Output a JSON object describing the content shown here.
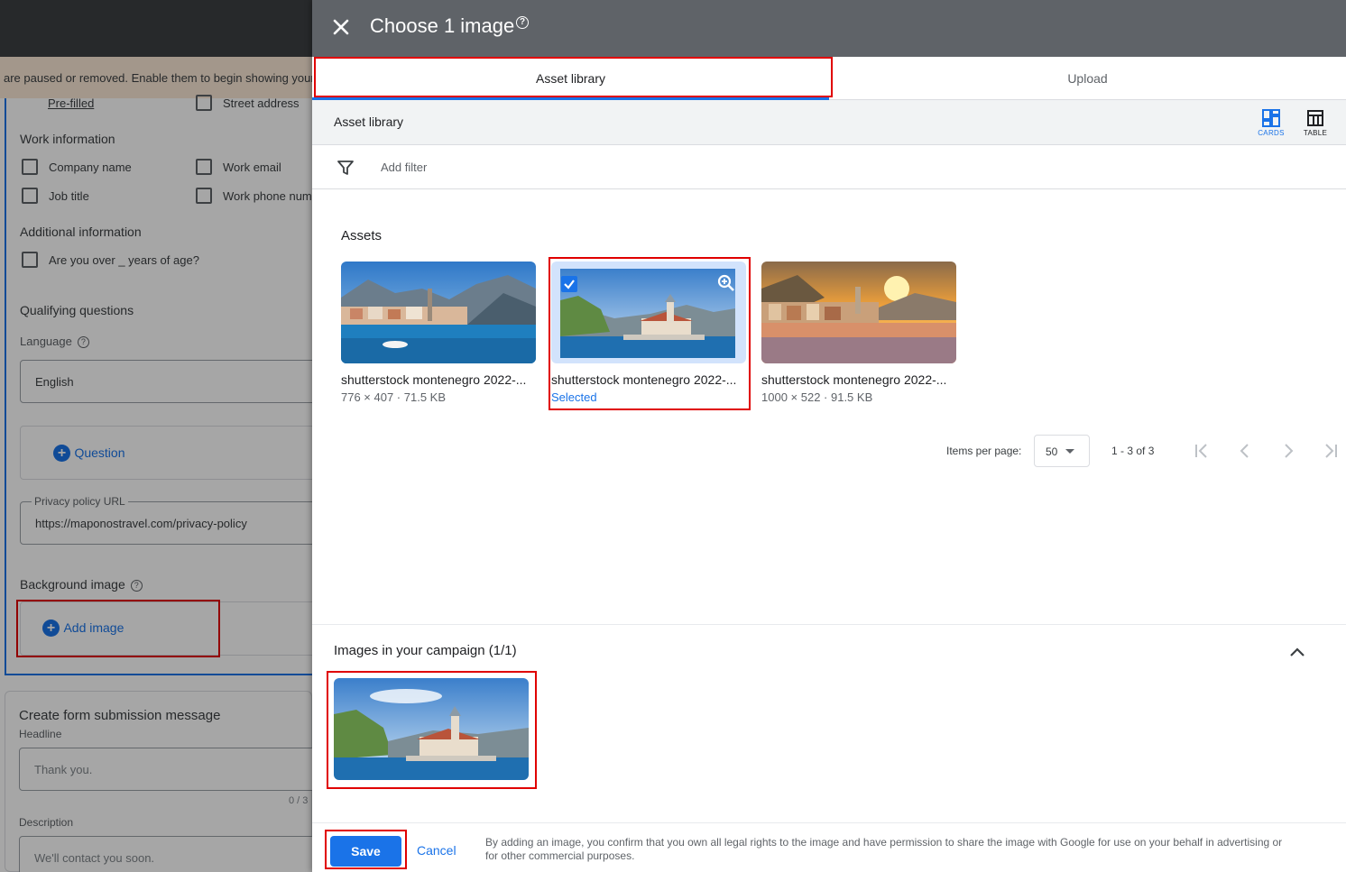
{
  "background_page": {
    "notice": "are paused or removed. Enable them to begin showing your",
    "prefilled_label": "Pre-filled",
    "street_address": "Street address",
    "work_info_title": "Work information",
    "company_name": "Company name",
    "work_email": "Work email",
    "job_title": "Job title",
    "work_phone": "Work phone numb",
    "additional_info_title": "Additional information",
    "age_question": "Are you over _ years of age?",
    "qualifying_title": "Qualifying questions",
    "language_label": "Language",
    "language_value": "English",
    "question_link": "Question",
    "privacy_label": "Privacy policy URL",
    "privacy_value": "https://maponostravel.com/privacy-policy",
    "bg_image_title": "Background image",
    "add_image": "Add image",
    "submission_title": "Create form submission message",
    "headline_label": "Headline",
    "headline_placeholder": "Thank you.",
    "headline_count": "0 / 3",
    "description_label": "Description",
    "description_placeholder": "We'll contact you soon."
  },
  "dialog": {
    "title": "Choose 1 image",
    "close_icon": "close-icon",
    "tabs": [
      {
        "label": "Asset library",
        "active": true
      },
      {
        "label": "Upload",
        "active": false
      }
    ],
    "library_title": "Asset library",
    "views": [
      {
        "label": "CARDS",
        "icon": "cards-icon",
        "active": true
      },
      {
        "label": "TABLE",
        "icon": "table-icon",
        "active": false
      }
    ],
    "filter_placeholder": "Add filter",
    "assets_heading": "Assets",
    "assets": [
      {
        "name": "shutterstock montenegro 2022-...",
        "meta": "776 × 407 · 71.5 KB",
        "selected": false
      },
      {
        "name": "shutterstock montenegro 2022-...",
        "meta": "Selected",
        "selected": true
      },
      {
        "name": "shutterstock montenegro 2022-...",
        "meta": "1000 × 522 · 91.5 KB",
        "selected": false
      }
    ],
    "pagination": {
      "items_per_page_label": "Items per page:",
      "items_per_page": "50",
      "range": "1 - 3 of 3"
    },
    "campaign": {
      "heading": "Images in your campaign (1/1)"
    },
    "footer": {
      "save": "Save",
      "cancel": "Cancel",
      "consent": "By adding an image, you confirm that you own all legal rights to the image and have permission to share the image with Google for use on your behalf in advertising or for other commercial purposes."
    }
  },
  "colors": {
    "accent": "#1a73e8",
    "highlight": "#e00000",
    "header": "#5f6368"
  }
}
